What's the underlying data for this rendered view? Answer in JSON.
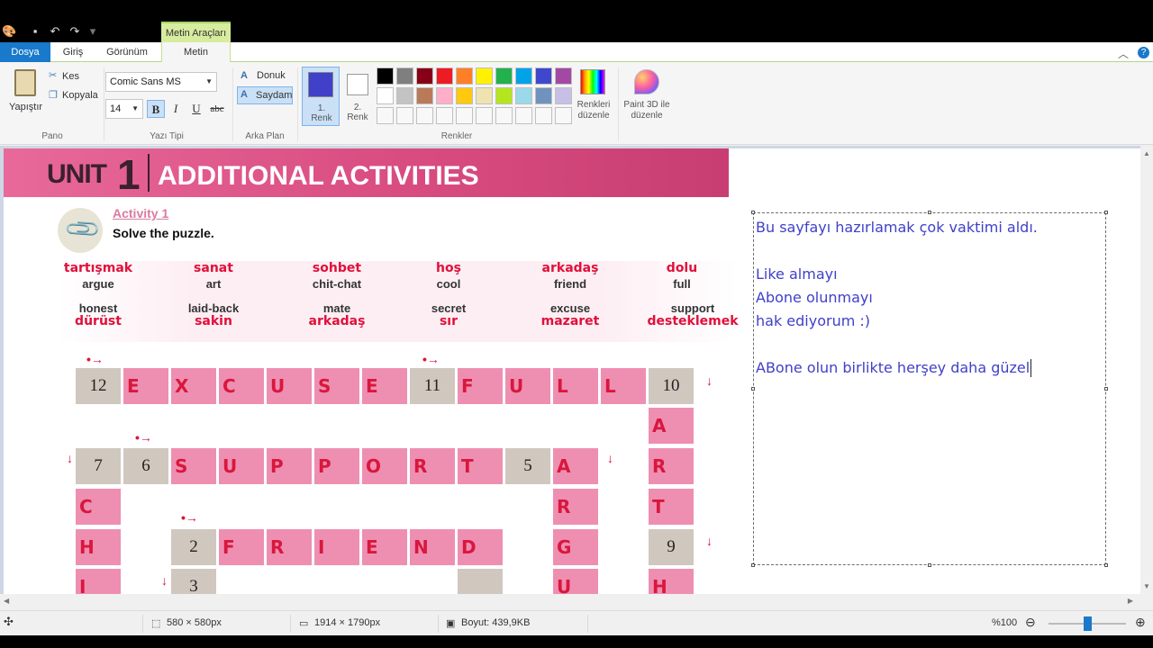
{
  "titlebar": {
    "context_tab": "Metin Araçları"
  },
  "tabs": {
    "file": "Dosya",
    "home": "Giriş",
    "view": "Görünüm",
    "text": "Metin"
  },
  "ribbon": {
    "clipboard": {
      "paste": "Yapıştır",
      "cut": "Kes",
      "copy": "Kopyala",
      "label": "Pano"
    },
    "font": {
      "family": "Comic Sans MS",
      "size": "14",
      "bold": "B",
      "italic": "I",
      "underline": "U",
      "strike": "abc",
      "label": "Yazı Tipi"
    },
    "background": {
      "opaque": "Donuk",
      "transparent": "Saydam",
      "label": "Arka Plan"
    },
    "colors": {
      "color1": "1. Renk",
      "color2": "2. Renk",
      "edit": "Renkleri düzenle",
      "paint3d": "Paint 3D ile düzenle",
      "label": "Renkler",
      "color1_value": "#4040c9",
      "color2_value": "#ffffff",
      "palette_row1": [
        "#000000",
        "#7f7f7f",
        "#880015",
        "#ed1c24",
        "#ff7f27",
        "#fff200",
        "#22b14c",
        "#00a2e8",
        "#3f48cc",
        "#a349a4"
      ],
      "palette_row2": [
        "#ffffff",
        "#c3c3c3",
        "#b97a57",
        "#ffaec9",
        "#ffc90e",
        "#efe4b0",
        "#b5e61d",
        "#99d9ea",
        "#7092be",
        "#c8bfe7"
      ]
    }
  },
  "worksheet": {
    "unit_word": "UNIT",
    "unit_number": "1",
    "title": "ADDITIONAL ACTIVITIES",
    "activity": "Activity 1",
    "instruction": "Solve the puzzle.",
    "vocab_top": [
      {
        "tr": "tartışmak",
        "en": "argue"
      },
      {
        "tr": "sanat",
        "en": "art"
      },
      {
        "tr": "sohbet",
        "en": "chit-chat"
      },
      {
        "tr": "hoş",
        "en": "cool"
      },
      {
        "tr": "arkadaş",
        "en": "friend"
      },
      {
        "tr": "dolu",
        "en": "full"
      }
    ],
    "vocab_bottom": [
      {
        "en": "honest",
        "tr": "dürüst"
      },
      {
        "en": "laid-back",
        "tr": "sakin"
      },
      {
        "en": "mate",
        "tr": "arkadaş"
      },
      {
        "en": "secret",
        "tr": "sır"
      },
      {
        "en": "excuse",
        "tr": "mazaret"
      },
      {
        "en": "support",
        "tr": "desteklemek"
      }
    ],
    "cells": [
      {
        "t": "12",
        "g": 1
      },
      {
        "t": "E"
      },
      {
        "t": "X"
      },
      {
        "t": "C"
      },
      {
        "t": "U"
      },
      {
        "t": "S"
      },
      {
        "t": "E"
      },
      {
        "t": "11",
        "g": 1
      },
      {
        "t": "F"
      },
      {
        "t": "U"
      },
      {
        "t": "L"
      },
      {
        "t": "L"
      },
      {
        "t": "10",
        "g": 1
      },
      {
        "t": "A"
      },
      {
        "t": "7",
        "g": 1
      },
      {
        "t": "6",
        "g": 1
      },
      {
        "t": "S"
      },
      {
        "t": "U"
      },
      {
        "t": "P"
      },
      {
        "t": "P"
      },
      {
        "t": "O"
      },
      {
        "t": "R"
      },
      {
        "t": "T"
      },
      {
        "t": "5",
        "g": 1
      },
      {
        "t": "A"
      },
      {
        "t": "R"
      },
      {
        "t": "C"
      },
      {
        "t": "R"
      },
      {
        "t": "T"
      },
      {
        "t": "2",
        "g": 1
      },
      {
        "t": "F"
      },
      {
        "t": "R"
      },
      {
        "t": "I"
      },
      {
        "t": "E"
      },
      {
        "t": "N"
      },
      {
        "t": "D"
      },
      {
        "t": "G"
      },
      {
        "t": "9",
        "g": 1
      },
      {
        "t": "H"
      },
      {
        "t": "I"
      },
      {
        "t": "3",
        "g": 1
      },
      {
        "t": "",
        "g": 1
      },
      {
        "t": "U"
      },
      {
        "t": "H"
      }
    ]
  },
  "textbox": {
    "lines": [
      "Bu sayfayı hazırlamak çok vaktimi aldı.",
      "",
      "Like almayı",
      "Abone olunmayı",
      "hak ediyorum :)",
      "",
      "ABone olun birlikte herşey daha güzel"
    ]
  },
  "status": {
    "selection": "580 × 580px",
    "image_size": "1914 × 1790px",
    "file_size": "Boyut: 439,9KB",
    "zoom": "%100",
    "zoom_fraction": 0.5
  }
}
